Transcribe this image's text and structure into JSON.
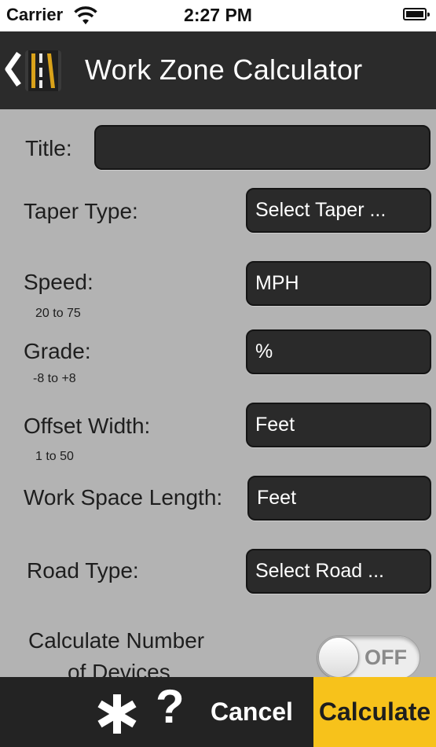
{
  "status_bar": {
    "carrier": "Carrier",
    "time": "2:27 PM"
  },
  "nav": {
    "title": "Work Zone Calculator"
  },
  "form": {
    "title_label": "Title:",
    "title_value": "",
    "taper_label": "Taper Type:",
    "taper_value": "Select Taper ...",
    "speed_label": "Speed:",
    "speed_hint": "20 to 75",
    "speed_value": "MPH",
    "grade_label": "Grade:",
    "grade_hint": "-8 to +8",
    "grade_value": "%",
    "offset_label": "Offset Width:",
    "offset_hint": "1 to 50",
    "offset_value": "Feet",
    "workspace_label": "Work Space Length:",
    "workspace_value": "Feet",
    "road_label": "Road Type:",
    "road_value": "Select Road ...",
    "devices_label_1": "Calculate Number",
    "devices_label_2": "of Devices",
    "devices_toggle": "OFF"
  },
  "toolbar": {
    "question": "?",
    "cancel": "Cancel",
    "calculate": "Calculate"
  },
  "colors": {
    "accent": "#f7c21b",
    "nav_bg": "#2b2b2b",
    "field_bg": "#2a2a2a",
    "content_bg": "#b3b3b3"
  }
}
